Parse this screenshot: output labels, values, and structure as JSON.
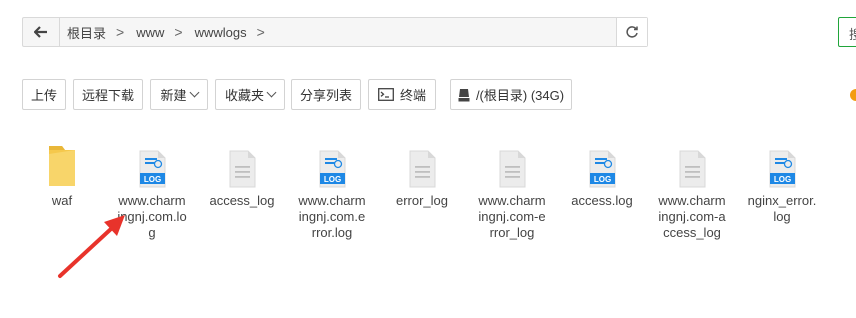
{
  "path_bar": {
    "crumbs": [
      "根目录",
      "www",
      "wwwlogs"
    ],
    "separator": ">"
  },
  "right_edge_char": "搜",
  "toolbar": {
    "upload": "上传",
    "remote_download": "远程下载",
    "new": "新建",
    "favorites": "收藏夹",
    "share_list": "分享列表",
    "terminal": "终端",
    "disk": "/(根目录) (34G)"
  },
  "files": [
    {
      "name": "waf",
      "type": "folder"
    },
    {
      "name": "www.charmingnj.com.log",
      "type": "log"
    },
    {
      "name": "access_log",
      "type": "generic"
    },
    {
      "name": "www.charmingnj.com.error.log",
      "type": "log"
    },
    {
      "name": "error_log",
      "type": "generic"
    },
    {
      "name": "www.charmingnj.com-error_log",
      "type": "generic"
    },
    {
      "name": "access.log",
      "type": "log"
    },
    {
      "name": "www.charmingnj.com-access_log",
      "type": "generic"
    },
    {
      "name": "nginx_error.log",
      "type": "log"
    }
  ],
  "icon_badge": "LOG",
  "colors": {
    "accent_green": "#20a53a",
    "log_blue": "#1e88e5",
    "folder_yellow": "#f5c84c",
    "annotation_red": "#e8332b"
  }
}
